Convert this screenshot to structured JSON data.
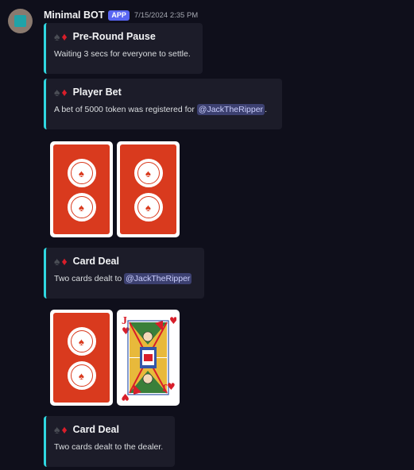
{
  "bot": {
    "name": "Minimal BOT",
    "badge": "APP",
    "timestamp": "7/15/2024 2:35 PM"
  },
  "embeds": [
    {
      "title": "Pre-Round Pause",
      "description": "Waiting 3 secs for everyone to settle."
    },
    {
      "title": "Player Bet",
      "description_prefix": "A bet of 5000 token was registered for ",
      "mention": "@JackTheRipper",
      "description_suffix": "."
    },
    {
      "title": "Card Deal",
      "description_prefix": "Two cards dealt to ",
      "mention": "@JackTheRipper"
    },
    {
      "title": "Card Deal",
      "description": "Two cards dealt to the dealer."
    }
  ],
  "icons": {
    "embed_title_icons": [
      "spade-icon",
      "diamond-icon"
    ],
    "card_back": "card-back-icon",
    "card_face": "jack-of-hearts-icon"
  },
  "colors": {
    "embed_accent": "#2fd7e0",
    "app_badge": "#5865f2",
    "card_back": "#d93a1e",
    "mention_bg": "#3c4070"
  },
  "cards": {
    "player": [
      "back",
      "back"
    ],
    "dealer": [
      "back",
      "J♥"
    ]
  }
}
